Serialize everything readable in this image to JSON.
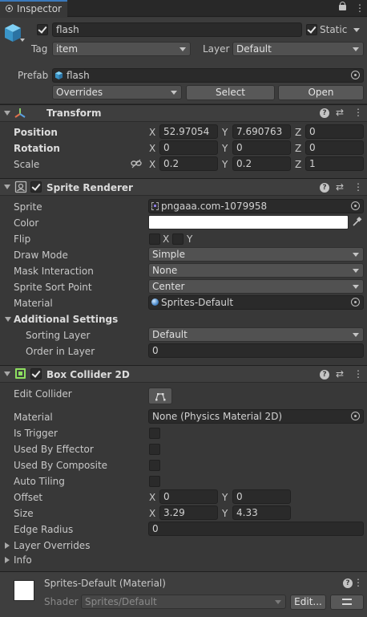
{
  "tab": {
    "title": "Inspector"
  },
  "object": {
    "name": "flash",
    "static_label": "Static",
    "tag_label": "Tag",
    "tag_value": "item",
    "layer_label": "Layer",
    "layer_value": "Default",
    "prefab_label": "Prefab",
    "prefab_value": "flash",
    "overrides_value": "Overrides",
    "select_label": "Select",
    "open_label": "Open"
  },
  "transform": {
    "title": "Transform",
    "position_label": "Position",
    "rotation_label": "Rotation",
    "scale_label": "Scale",
    "pos": {
      "x": "52.97054",
      "y": "7.690763",
      "z": "0"
    },
    "rot": {
      "x": "0",
      "y": "0",
      "z": "0"
    },
    "scale": {
      "x": "0.2",
      "y": "0.2",
      "z": "1"
    },
    "axis": {
      "x": "X",
      "y": "Y",
      "z": "Z"
    }
  },
  "sprite_renderer": {
    "title": "Sprite Renderer",
    "sprite_label": "Sprite",
    "sprite_value": "pngaaa.com-1079958",
    "color_label": "Color",
    "color_value": "#ffffff",
    "flip_label": "Flip",
    "flip_x": "X",
    "flip_y": "Y",
    "draw_mode_label": "Draw Mode",
    "draw_mode_value": "Simple",
    "mask_label": "Mask Interaction",
    "mask_value": "None",
    "sort_point_label": "Sprite Sort Point",
    "sort_point_value": "Center",
    "material_label": "Material",
    "material_value": "Sprites-Default",
    "additional_label": "Additional Settings",
    "sorting_layer_label": "Sorting Layer",
    "sorting_layer_value": "Default",
    "order_label": "Order in Layer",
    "order_value": "0"
  },
  "box_collider": {
    "title": "Box Collider 2D",
    "edit_collider_label": "Edit Collider",
    "material_label": "Material",
    "material_value": "None (Physics Material 2D)",
    "is_trigger_label": "Is Trigger",
    "used_by_effector_label": "Used By Effector",
    "used_by_composite_label": "Used By Composite",
    "auto_tiling_label": "Auto Tiling",
    "offset_label": "Offset",
    "offset": {
      "x": "0",
      "y": "0"
    },
    "size_label": "Size",
    "size": {
      "x": "3.29",
      "y": "4.33"
    },
    "edge_radius_label": "Edge Radius",
    "edge_radius_value": "0",
    "layer_overrides_label": "Layer Overrides",
    "info_label": "Info"
  },
  "material_footer": {
    "title": "Sprites-Default (Material)",
    "shader_label": "Shader",
    "shader_value": "Sprites/Default",
    "edit_label": "Edit..."
  },
  "colors": {
    "background": "#383838",
    "header": "#3e3e3e",
    "field": "#2a2a2a",
    "accent_blue": "#4aa8e0",
    "collider_green": "#8ee060"
  }
}
